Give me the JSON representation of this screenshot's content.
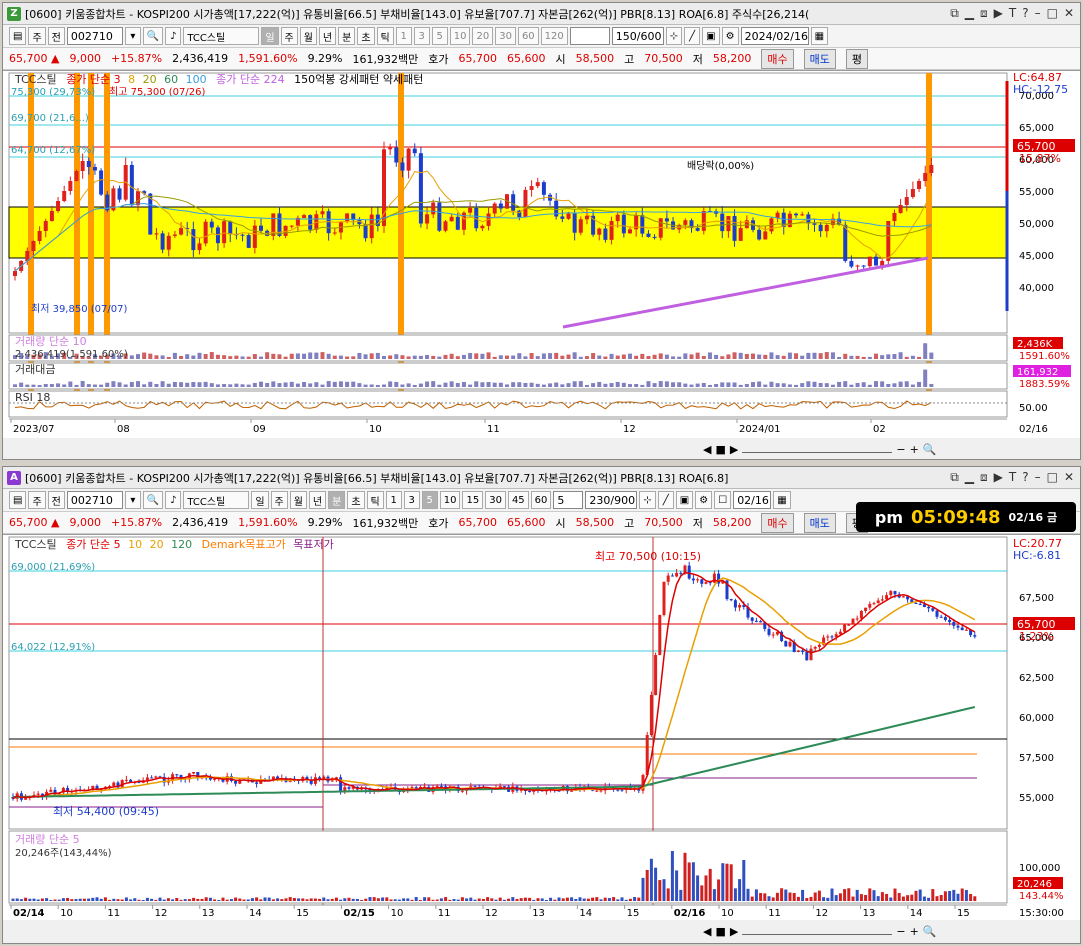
{
  "top": {
    "icon": "Z",
    "title": "[0600] 키움종합차트 - KOSPI200 시가총액[17,222(억)] 유통비율[66.5] 부채비율[143.0] 유보율[707.7] 자본금[262(억)] PBR[8.13] ROA[6.8] 주식수[26,214(",
    "toolbar": {
      "market": "주",
      "prev": "전",
      "code": "002710",
      "indicator": "TCC스틸",
      "periods": [
        "일",
        "주",
        "월",
        "년",
        "분",
        "초",
        "틱"
      ],
      "selected_period": "일",
      "nums": [
        "1",
        "3",
        "5",
        "10",
        "20",
        "30",
        "60",
        "120"
      ],
      "count": "150/600",
      "date": "2024/02/16"
    },
    "info": {
      "price": "65,700",
      "change": "9,000",
      "rate": "+15.87%",
      "volume": "2,436,419",
      "vol_rate": "1,591.60%",
      "turnover": "9.29%",
      "amount": "161,932백만",
      "quote_label": "호가",
      "ask": "65,700",
      "bid": "65,600",
      "open_label": "시",
      "open": "58,500",
      "high_label": "고",
      "high": "70,500",
      "low_label": "저",
      "low": "58,200",
      "buy": "매수",
      "sell": "매도",
      "eval": "평"
    },
    "legend": {
      "name": "TCC스틸",
      "ma": "종가 단순 3",
      "ma_vals": [
        "8",
        "20",
        "60",
        "100"
      ],
      "ma2": "종가 단순 224",
      "pattern": "150억봉 강세패턴 약세패턴"
    },
    "lc": "LC:64.87",
    "hc": "HC:-12.75",
    "levels": [
      "75,300 (29,73%)",
      "69,700 (21,6...)",
      "64,700 (12,67%)"
    ],
    "max_label": "최고 75,300 (07/26)",
    "min_label": "최저 39,850 (07/07)",
    "div_label": "배당락(0,00%)",
    "price_tag": "65,700",
    "price_pct": "15.87%",
    "y_ticks": [
      "70,000",
      "65,000",
      "60,000",
      "55,000",
      "50,000",
      "45,000",
      "40,000"
    ],
    "vol_label": "거래량 단순 10",
    "vol_sub": "2,436,419(1,591.60%)",
    "vol_tag": "2,436K",
    "vol_tag_pct": "1591.60%",
    "amt_label": "거래대금",
    "amt_tag": "161,932",
    "amt_tag_pct": "1883.59%",
    "rsi_label": "RSI 18",
    "rsi_tick": "50.00",
    "x_ticks": [
      "2023/07",
      "08",
      "09",
      "10",
      "11",
      "12",
      "2024/01",
      "02"
    ],
    "x_end": "02/16"
  },
  "bottom": {
    "icon": "A",
    "title": "[0600] 키움종합차트 - KOSPI200 시가총액[17,222(억)] 유통비율[66.5] 부채비율[143.0] 유보율[707.7] 자본금[262(억)] PBR[8.13] ROA[6.8]",
    "toolbar": {
      "market": "주",
      "prev": "전",
      "code": "002710",
      "indicator": "TCC스틸",
      "periods": [
        "일",
        "주",
        "월",
        "년",
        "분",
        "초",
        "틱"
      ],
      "selected_period": "분",
      "nums": [
        "1",
        "3",
        "5",
        "10",
        "15",
        "30",
        "45",
        "60"
      ],
      "selected_num": "5",
      "interval": "5",
      "count": "230/900",
      "date": "02/16"
    },
    "info": {
      "price": "65,700",
      "change": "9,000",
      "rate": "+15.87%",
      "volume": "2,436,419",
      "vol_rate": "1,591.60%",
      "turnover": "9.29%",
      "amount": "161,932백만",
      "quote_label": "호가",
      "ask": "65,700",
      "bid": "65,600",
      "open_label": "시",
      "open": "58,500",
      "high_label": "고",
      "high": "70,500",
      "low_label": "저",
      "low": "58,200",
      "buy": "매수",
      "sell": "매도",
      "eval": "평"
    },
    "legend": {
      "name": "TCC스틸",
      "ma": "종가 단순 5",
      "ma_vals": [
        "10",
        "20",
        "120"
      ],
      "demark_hi": "Demark목표고가",
      "demark_lo": "목표저가"
    },
    "lc": "LC:20.77",
    "hc": "HC:-6.81",
    "levels": [
      "69,000 (21,69%)",
      "64,022 (12,91%)"
    ],
    "max_label": "최고 70,500 (10:15)",
    "min_label": "최저 54,400 (09:45)",
    "price_tag": "65,700",
    "price_pct": "1.23%",
    "y_ticks": [
      "67,500",
      "65,000",
      "62,500",
      "60,000",
      "57,500",
      "55,000"
    ],
    "vol_label": "거래량 단순 5",
    "vol_sub": "20,246주(143,44%)",
    "vol_tag": "20,246",
    "vol_tag_pct": "143.44%",
    "vol_tick": "100,000",
    "x_ticks": [
      "02/14",
      "10",
      "11",
      "12",
      "13",
      "14",
      "15",
      "02/15",
      "10",
      "11",
      "12",
      "13",
      "14",
      "15",
      "02/16",
      "10",
      "11",
      "12",
      "13",
      "14",
      "15"
    ],
    "x_end": "15:30:00"
  },
  "clock": {
    "ampm": "pm",
    "time": "05:09:48",
    "date": "02/16 금"
  },
  "colors": {
    "up": "#e0201c",
    "down": "#1c3ccc",
    "band": "#ffff00",
    "orange": "#ff9900",
    "cyan": "#40d0e0",
    "green": "#2e8b57",
    "purple": "#c060e0"
  }
}
